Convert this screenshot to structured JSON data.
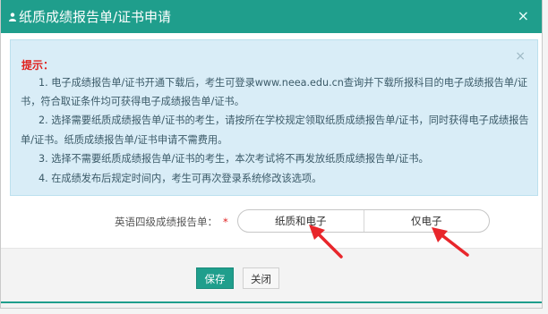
{
  "dialog": {
    "title": "纸质成绩报告单/证书申请",
    "close_glyph": "×"
  },
  "tip": {
    "close_glyph": "×",
    "title": "提示：",
    "lines": [
      "1. 电子成绩报告单/证书开通下载后，考生可登录www.neea.edu.cn查询并下载所报科目的电子成绩报告单/证",
      "书，符合取证条件均可获得电子成绩报告单/证书。",
      "2. 选择需要纸质成绩报告单/证书的考生，请按所在学校规定领取纸质成绩报告单/证书，同时获得电子成绩报告",
      "单/证书。纸质成绩报告单/证书申请不需费用。",
      "3. 选择不需要纸质成绩报告单/证书的考生，本次考试将不再发放纸质成绩报告单/证书。",
      "4. 在成绩发布后规定时间内，考生可再次登录系统修改该选项。"
    ]
  },
  "form": {
    "label": "英语四级成绩报告单：",
    "required_mark": "*",
    "options": [
      "纸质和电子",
      "仅电子"
    ]
  },
  "footer": {
    "save_label": "保存",
    "close_label": "关闭"
  },
  "colors": {
    "header": "#1f9e8c",
    "tip_bg": "#d9edf7",
    "tip_title": "#e0211d",
    "arrow": "#e8262b"
  }
}
